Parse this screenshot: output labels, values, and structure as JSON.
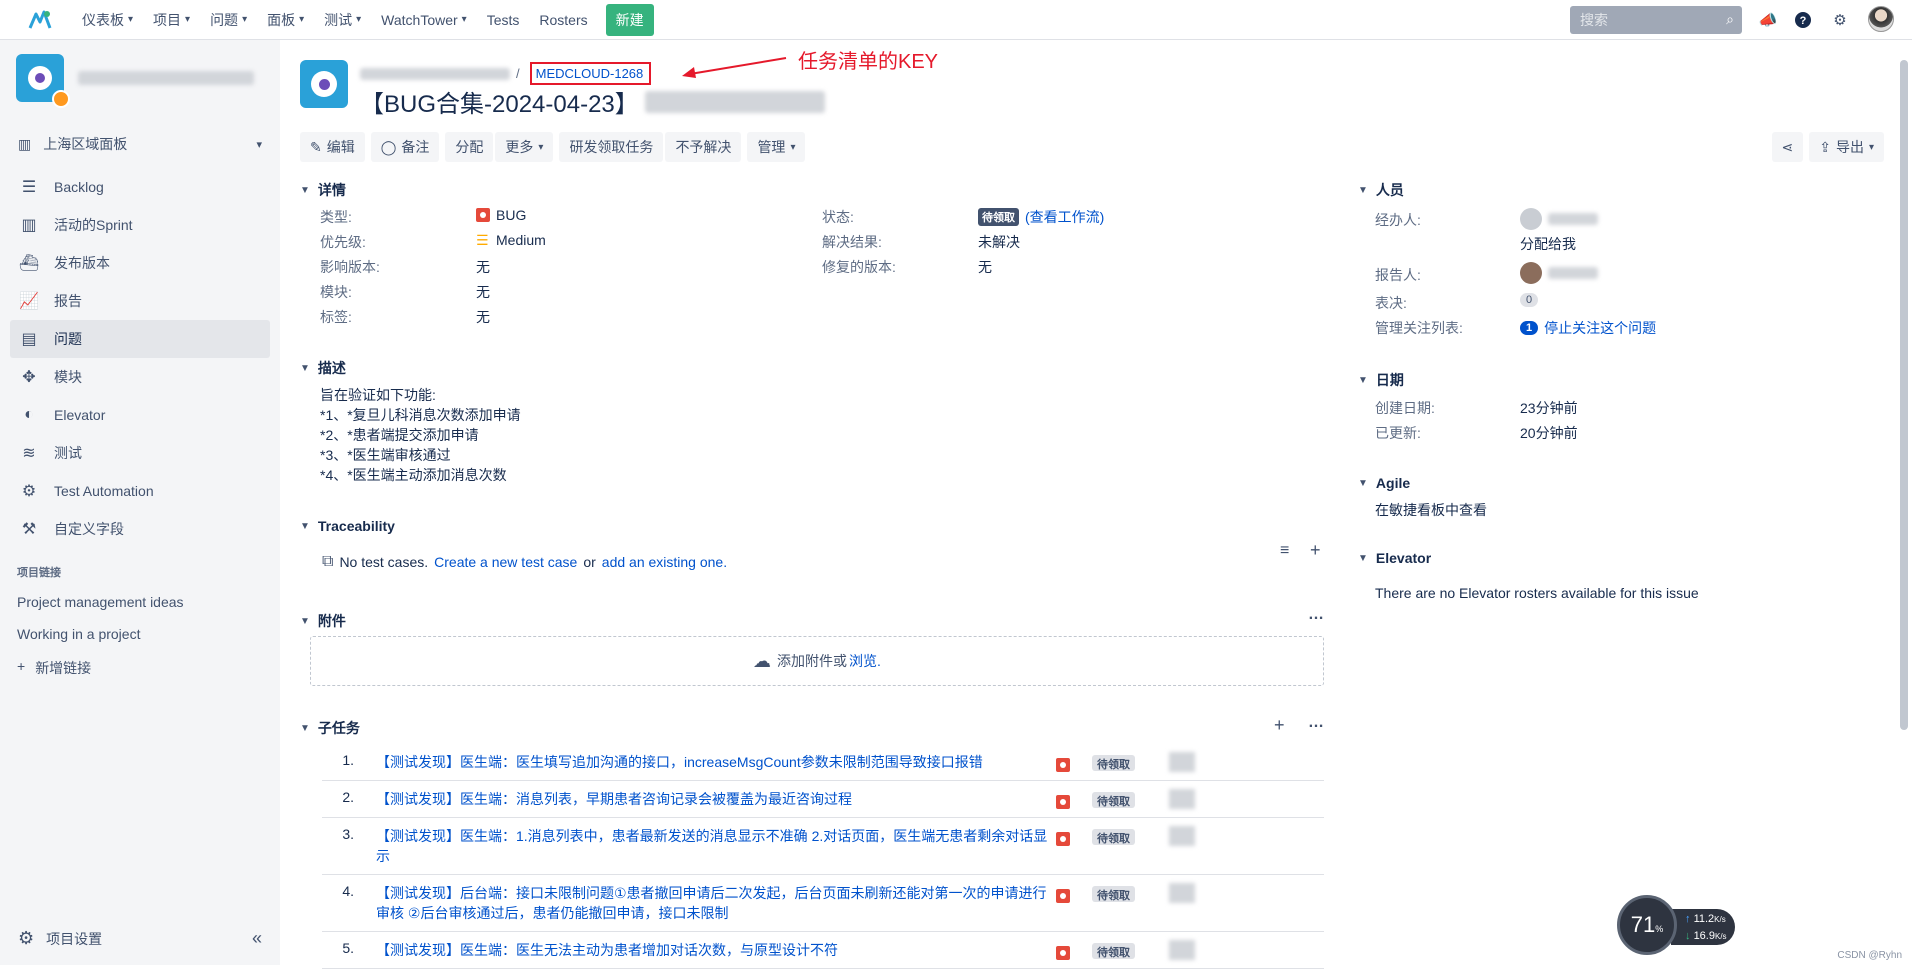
{
  "topnav": {
    "items": [
      {
        "label": "仪表板",
        "dropdown": true
      },
      {
        "label": "项目",
        "dropdown": true
      },
      {
        "label": "问题",
        "dropdown": true
      },
      {
        "label": "面板",
        "dropdown": true
      },
      {
        "label": "测试",
        "dropdown": true
      },
      {
        "label": "WatchTower",
        "dropdown": true
      },
      {
        "label": "Tests",
        "dropdown": false
      },
      {
        "label": "Rosters",
        "dropdown": false
      }
    ],
    "create_label": "新建",
    "search_placeholder": "搜索"
  },
  "sidebar": {
    "board_label": "上海区域面板",
    "items": [
      {
        "label": "Backlog",
        "icon": "backlog-icon"
      },
      {
        "label": "活动的Sprint",
        "icon": "sprint-icon"
      },
      {
        "label": "发布版本",
        "icon": "ship-icon"
      },
      {
        "label": "报告",
        "icon": "chart-icon"
      },
      {
        "label": "问题",
        "icon": "issues-icon"
      },
      {
        "label": "模块",
        "icon": "puzzle-icon"
      },
      {
        "label": "Elevator",
        "icon": "elevator-icon"
      },
      {
        "label": "测试",
        "icon": "test-icon"
      },
      {
        "label": "Test Automation",
        "icon": "automation-icon"
      },
      {
        "label": "自定义字段",
        "icon": "fields-icon"
      }
    ],
    "links_section": "项目链接",
    "links": [
      "Project management ideas",
      "Working in a project"
    ],
    "add_link": "新增链接",
    "settings_label": "项目设置"
  },
  "issue": {
    "key": "MEDCLOUD-1268",
    "annotation": "任务清单的KEY",
    "title": "【BUG合集-2024-04-23】"
  },
  "toolbar": {
    "edit": "编辑",
    "comment": "备注",
    "assign": "分配",
    "more": "更多",
    "dev_claim": "研发领取任务",
    "wont_fix": "不予解决",
    "admin": "管理",
    "export": "导出"
  },
  "details": {
    "title": "详情",
    "type_label": "类型:",
    "type_value": "BUG",
    "priority_label": "优先级:",
    "priority_value": "Medium",
    "affects_label": "影响版本:",
    "affects_value": "无",
    "component_label": "模块:",
    "component_value": "无",
    "labels_label": "标签:",
    "labels_value": "无",
    "status_label": "状态:",
    "status_value": "待领取",
    "workflow_link": "(查看工作流)",
    "resolution_label": "解决结果:",
    "resolution_value": "未解决",
    "fix_label": "修复的版本:",
    "fix_value": "无"
  },
  "description": {
    "title": "描述",
    "lines": [
      "旨在验证如下功能:",
      "*1、*复旦儿科消息次数添加申请",
      "*2、*患者端提交添加申请",
      "*3、*医生端审核通过",
      "*4、*医生端主动添加消息次数"
    ]
  },
  "traceability": {
    "title": "Traceability",
    "text": "No test cases.",
    "create_link": "Create a new test case",
    "or": "or",
    "existing_link": "add an existing one."
  },
  "attachments": {
    "title": "附件",
    "drop_text": "添加附件或",
    "browse": "浏览."
  },
  "subtasks": {
    "title": "子任务",
    "rows": [
      {
        "num": "1.",
        "title": "【测试发现】医生端：医生填写追加沟通的接口，increaseMsgCount参数未限制范围导致接口报错",
        "status": "待领取"
      },
      {
        "num": "2.",
        "title": "【测试发现】医生端：消息列表，早期患者咨询记录会被覆盖为最近咨询过程",
        "status": "待领取"
      },
      {
        "num": "3.",
        "title": "【测试发现】医生端：1.消息列表中，患者最新发送的消息显示不准确 2.对话页面，医生端无患者剩余对话显示",
        "status": "待领取"
      },
      {
        "num": "4.",
        "title": "【测试发现】后台端：接口未限制问题①患者撤回申请后二次发起，后台页面未刷新还能对第一次的申请进行审核 ②后台审核通过后，患者仍能撤回申请，接口未限制",
        "status": "待领取"
      },
      {
        "num": "5.",
        "title": "【测试发现】医生端：医生无法主动为患者增加对话次数，与原型设计不符",
        "status": "待领取"
      }
    ]
  },
  "people": {
    "title": "人员",
    "assignee_label": "经办人:",
    "assign_to_me": "分配给我",
    "reporter_label": "报告人:",
    "votes_label": "表决:",
    "votes_value": "0",
    "watchers_label": "管理关注列表:",
    "watchers_value": "1",
    "stop_watch": "停止关注这个问题"
  },
  "dates": {
    "title": "日期",
    "created_label": "创建日期:",
    "created_value": "23分钟前",
    "updated_label": "已更新:",
    "updated_value": "20分钟前"
  },
  "agile": {
    "title": "Agile",
    "link": "在敏捷看板中查看"
  },
  "elevator": {
    "title": "Elevator",
    "text": "There are no Elevator rosters available for this issue"
  },
  "speed_widget": {
    "percent": "71",
    "percent_unit": "%",
    "up": "11.2",
    "up_unit": "K/s",
    "down": "16.9",
    "down_unit": "K/s"
  },
  "watermark": "CSDN @Ryhn"
}
